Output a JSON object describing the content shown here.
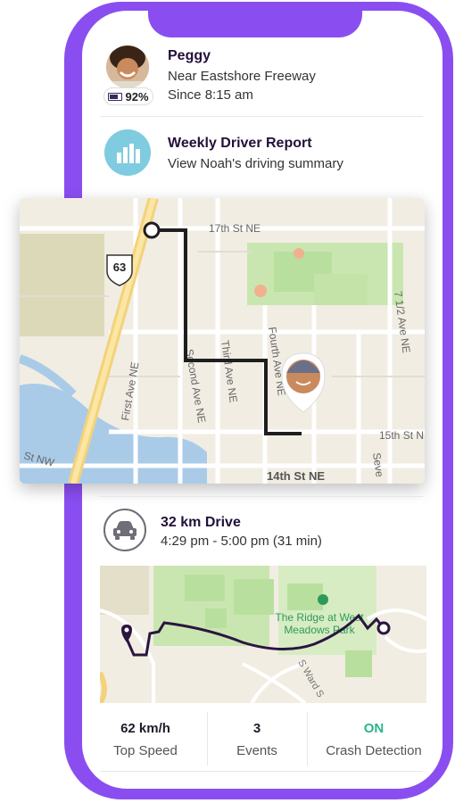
{
  "member": {
    "name": "Peggy",
    "location": "Near Eastshore Freeway",
    "since": "Since 8:15 am",
    "battery": "92%"
  },
  "report": {
    "title": "Weekly Driver Report",
    "subtitle": "View Noah's driving summary"
  },
  "map": {
    "streets": [
      "17th St NE",
      "Second Ave NE",
      "Third Ave NE",
      "Fourth Ave NE",
      "First Ave NE",
      "7 1/2 Ave NE",
      "15th St N",
      "14th St NE",
      "St NW",
      "Seve"
    ],
    "route_shield": "63"
  },
  "drive": {
    "title": "32 km Drive",
    "time": "4:29 pm - 5:00 pm (31 min)",
    "park_label_line1": "The Ridge at West",
    "park_label_line2": "Meadows Park",
    "street_label": "S Ward S"
  },
  "stats": [
    {
      "value": "62 km/h",
      "label": "Top Speed"
    },
    {
      "value": "3",
      "label": "Events"
    },
    {
      "value": "ON",
      "label": "Crash Detection"
    }
  ],
  "colors": {
    "phone": "#8a4ef0",
    "accent_green": "#2bb48c",
    "route": "#2a1540"
  }
}
